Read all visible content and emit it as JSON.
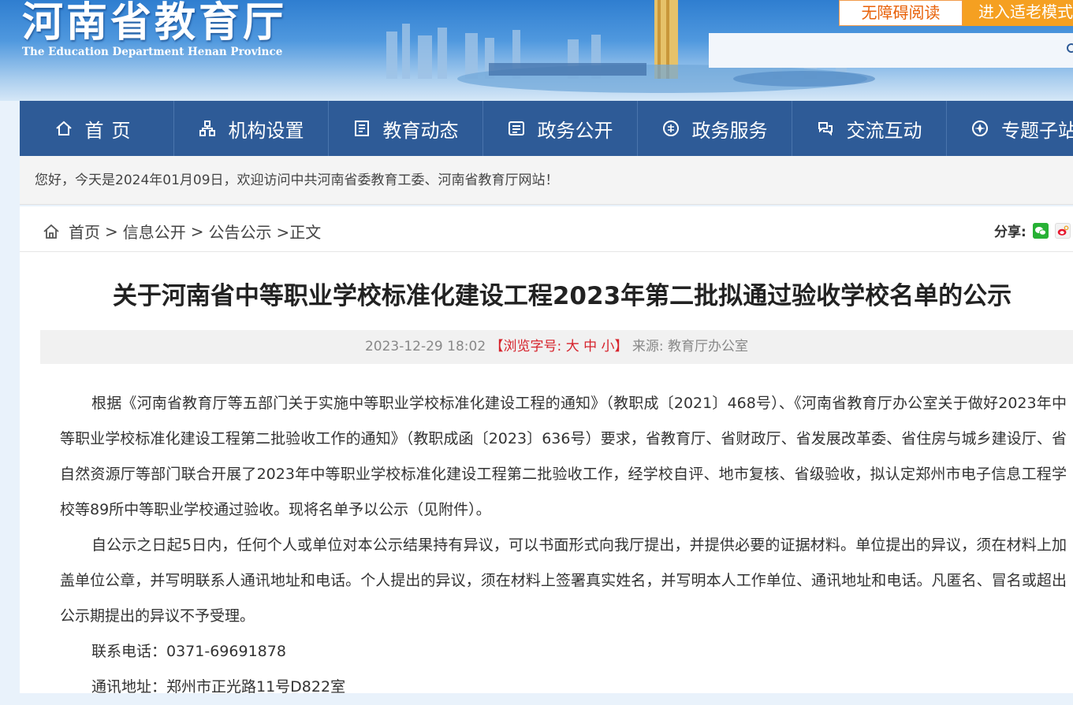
{
  "header": {
    "site_title": "河南省教育厅",
    "site_subtitle": "The Education Department Henan Province",
    "accessibility_button": "无障碍阅读",
    "elder_mode_button": "进入适老模式",
    "search": {
      "value": "",
      "placeholder": ""
    }
  },
  "nav": {
    "items": [
      {
        "label": "首页",
        "icon": "home-icon"
      },
      {
        "label": "机构设置",
        "icon": "org-icon"
      },
      {
        "label": "教育动态",
        "icon": "news-icon"
      },
      {
        "label": "政务公开",
        "icon": "gov-open-icon"
      },
      {
        "label": "政务服务",
        "icon": "gov-service-icon"
      },
      {
        "label": "交流互动",
        "icon": "interaction-icon"
      },
      {
        "label": "专题子站",
        "icon": "topics-icon"
      }
    ]
  },
  "welcome": "您好，今天是2024年01月09日，欢迎访问中共河南省委教育工委、河南省教育厅网站！",
  "breadcrumb": {
    "items": [
      "首页",
      "信息公开",
      "公告公示"
    ],
    "current": ">正文",
    "separator": ">"
  },
  "share": {
    "label": "分享:",
    "icons": [
      "wechat-icon",
      "weibo-icon"
    ]
  },
  "article": {
    "title": "关于河南省中等职业学校标准化建设工程2023年第二批拟通过验收学校名单的公示",
    "meta": {
      "datetime": "2023-12-29 18:02",
      "font_size_label": "【浏览字号:",
      "font_large": "大",
      "font_medium": "中",
      "font_small": "小",
      "font_size_close": "】",
      "source": "来源:  教育厅办公室"
    },
    "paragraphs": [
      "根据《河南省教育厅等五部门关于实施中等职业学校标准化建设工程的通知》（教职成〔2021〕468号）、《河南省教育厅办公室关于做好2023年中等职业学校标准化建设工程第二批验收工作的通知》（教职成函〔2023〕636号）要求，省教育厅、省财政厅、省发展改革委、省住房与城乡建设厅、省自然资源厅等部门联合开展了2023年中等职业学校标准化建设工程第二批验收工作，经学校自评、地市复核、省级验收，拟认定郑州市电子信息工程学校等89所中等职业学校通过验收。现将名单予以公示（见附件）。",
      "自公示之日起5日内，任何个人或单位对本公示结果持有异议，可以书面形式向我厅提出，并提供必要的证据材料。单位提出的异议，须在材料上加盖单位公章，并写明联系人通讯地址和电话。个人提出的异议，须在材料上签署真实姓名，并写明本人工作单位、通讯地址和电话。凡匿名、冒名或超出公示期提出的异议不予受理。"
    ],
    "contact_phone": "联系电话：0371-69691878",
    "contact_address": "通讯地址：郑州市正光路11号D822室"
  },
  "colors": {
    "nav_bg": "#2e5b97",
    "accent_orange": "#f5a021",
    "font_size_red": "#d6232c"
  }
}
